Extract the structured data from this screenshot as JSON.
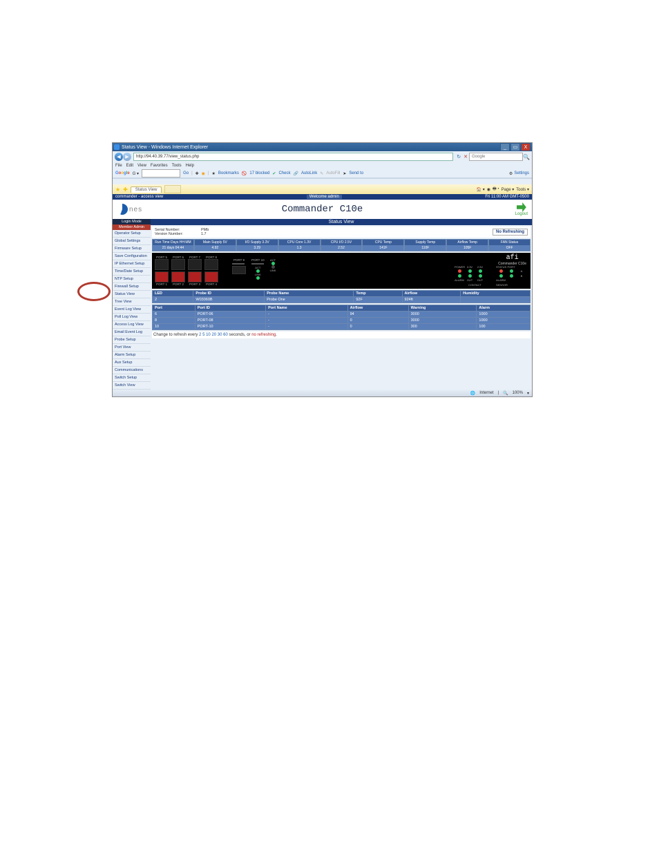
{
  "window": {
    "title": "Status View - Windows Internet Explorer",
    "url": "http://94.40.39.77/view_status.php",
    "search_placeholder": "Google",
    "win_min": "_",
    "win_max": "▭",
    "win_close": "X"
  },
  "menus": [
    "File",
    "Edit",
    "View",
    "Favorites",
    "Tools",
    "Help"
  ],
  "google_toolbar": {
    "label": "Google",
    "items": [
      "Go",
      "Bookmarks",
      "17 blocked",
      "Check",
      "AutoLink",
      "AutoFill",
      "Send to"
    ],
    "settings": "Settings"
  },
  "tab": {
    "title": "Status View"
  },
  "ie_tools": [
    "Home",
    "Feeds",
    "Print",
    "Page",
    "Tools"
  ],
  "commander_bar": {
    "left": "commander - access view",
    "welcome": "Welcome admin",
    "time": "Fri 11:00 AM GMT-0500"
  },
  "header": {
    "brand": "nes",
    "title": "Commander C10e",
    "logout": "Logout"
  },
  "sidebar": {
    "login_mode": "Login Mode",
    "admin": "Member Admin",
    "items": [
      "Operator Setup",
      "Global Settings",
      "Firmware Setup",
      "Save Configuration",
      "IP Ethernet Setup",
      "Time/Date Setup",
      "NTP Setup",
      "Firewall Setup",
      "Status View",
      "Tree View",
      "Event Log View",
      "Poll Log View",
      "Access Log View",
      "Email Event Log",
      "Probe Setup",
      "Port View",
      "Alarm Setup",
      "Aux Setup",
      "Communications",
      "Switch Setup",
      "Switch View"
    ]
  },
  "status": {
    "title": "Status View",
    "serial_label": "Serial Number:",
    "version_label": "Version Number:",
    "pmb_label": "PMb",
    "pmb_val": "1.7",
    "no_refreshing": "No Refreshing"
  },
  "metrics": {
    "headers": [
      "Run Time Days HH:MM",
      "Main Supply 5V",
      "I/O Supply 3.3V",
      "CPU Core 1.3V",
      "CPU I/O 2.5V",
      "CPU Temp",
      "Supply Temp",
      "Airflow Temp",
      "FAN Status"
    ],
    "values": [
      "21 days 04:44",
      "4.92",
      "3.29",
      "1.3",
      "2.52",
      "141F",
      "110F",
      "105F",
      "OFF"
    ]
  },
  "ports": {
    "top": [
      "PORT 5",
      "PORT 6",
      "PORT 7",
      "PORT 8"
    ],
    "bottom": [
      "PORT 1",
      "PORT 2",
      "PORT 3",
      "PORT 4"
    ],
    "extra": [
      "PORT 9",
      "PORT 10"
    ],
    "brand": "afi",
    "brand_sub": "Commander C10e",
    "led_headers": [
      "ACT",
      "POWER",
      "3.3V",
      "2.5V",
      "STATUS",
      "PORT"
    ],
    "led_row2": [
      "LINK",
      "ALARM",
      "OUT",
      "OUT",
      "ALARM",
      ""
    ],
    "contact": "CONTACT",
    "sensor": "SENSOR"
  },
  "probe_table": {
    "headers": [
      "LED",
      "Probe ID",
      "Probe Name",
      "Temp",
      "Airflow",
      "Humidity"
    ],
    "rows": [
      [
        "2",
        "W03060B",
        "Probe One",
        "92F",
        "924ft",
        ""
      ]
    ]
  },
  "port_table": {
    "headers": [
      "Port",
      "Port ID",
      "Port Name",
      "Airflow",
      "Warning",
      "Alarm"
    ],
    "rows": [
      [
        "6",
        "PORT-06",
        "-",
        "94",
        "3000",
        "1000"
      ],
      [
        "8",
        "PORT-08",
        "-",
        "0",
        "3000",
        "1000"
      ],
      [
        "10",
        "PORT-10",
        "-",
        "0",
        "300",
        "100"
      ]
    ]
  },
  "refresh": {
    "pre": "Change to refresh every ",
    "opts": [
      "2",
      "5",
      "10",
      "20",
      "30",
      "60"
    ],
    "post": " seconds, or ",
    "nor": "no refreshing",
    "dot": "."
  },
  "statusbar": {
    "internet": "Internet",
    "zoom": "100%"
  }
}
